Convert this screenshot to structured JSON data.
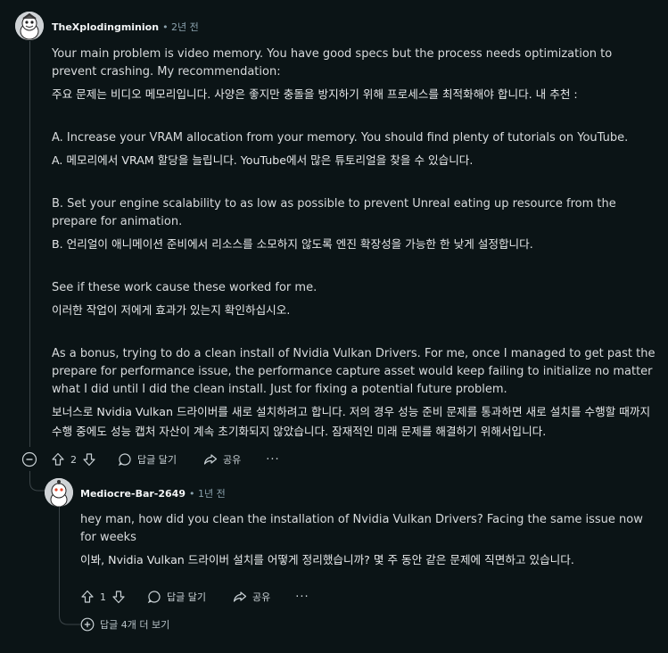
{
  "comment1": {
    "username": "TheXplodingminion",
    "time": "• 2년 전",
    "paragraphs": [
      {
        "en": "Your main problem is video memory. You have good specs but the process needs optimization to prevent crashing. My recommendation:",
        "ko": "주요 문제는 비디오 메모리입니다. 사양은 좋지만 충돌을 방지하기 위해 프로세스를 최적화해야 합니다. 내 추천 :"
      },
      {
        "en": "A. Increase your VRAM allocation from your memory. You should find plenty of tutorials on YouTube.",
        "ko": "A. 메모리에서 VRAM 할당을 늘립니다. YouTube에서 많은 튜토리얼을 찾을 수 있습니다."
      },
      {
        "en": "B. Set your engine scalability to as low as possible to prevent Unreal eating up resource from the prepare for animation.",
        "ko": "B. 언리얼이 애니메이션 준비에서 리소스를 소모하지 않도록 엔진 확장성을 가능한 한 낮게 설정합니다."
      },
      {
        "en": "See if these work cause these worked for me.",
        "ko": "이러한 작업이 저에게 효과가 있는지 확인하십시오."
      },
      {
        "en": "As a bonus, trying to do a clean install of Nvidia Vulkan Drivers. For me, once I managed to get past the prepare for performance issue, the performance capture asset would keep failing to initialize no matter what I did until I did the clean install. Just for fixing a potential future problem.",
        "ko": "보너스로 Nvidia Vulkan 드라이버를 새로 설치하려고 합니다. 저의 경우 성능 준비 문제를 통과하면 새로 설치를 수행할 때까지 수행 중에도 성능 캡처 자산이 계속 초기화되지 않았습니다. 잠재적인 미래 문제를 해결하기 위해서입니다."
      }
    ],
    "vote_count": "2",
    "reply_label": "답글 달기",
    "share_label": "공유",
    "more_label": "···"
  },
  "comment2": {
    "username": "Mediocre-Bar-2649",
    "time": "• 1년 전",
    "paragraphs": [
      {
        "en": "hey man, how did you clean the installation of Nvidia Vulkan Drivers? Facing the same issue now for weeks",
        "ko": "이봐, Nvidia Vulkan 드라이버 설치를 어떻게 정리했습니까? 몇 주 동안 같은 문제에 직면하고 있습니다."
      }
    ],
    "vote_count": "1",
    "reply_label": "답글 달기",
    "share_label": "공유",
    "more_label": "···"
  },
  "more_replies": {
    "label": "답글 4개 더 보기"
  },
  "colors": {
    "background": "#0b1416",
    "text": "#d7dadc",
    "thread_line": "#3b4448",
    "meta": "#8ba2ad"
  },
  "icons": [
    "avatar-icon",
    "collapse-icon",
    "upvote-icon",
    "downvote-icon",
    "comment-icon",
    "share-icon",
    "overflow-icon",
    "expand-icon"
  ]
}
